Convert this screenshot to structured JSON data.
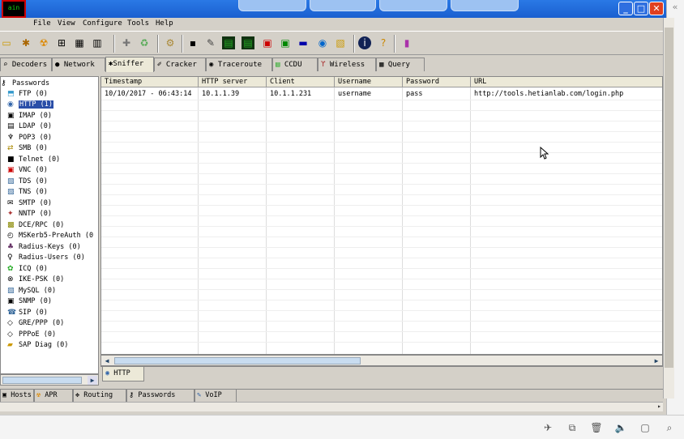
{
  "titlebar": {
    "app_icon_text": "ain",
    "buttons": {
      "minimize": "_",
      "maximize": "□",
      "close": "✕"
    }
  },
  "menubar": [
    "File",
    "View",
    "Configure",
    "Tools",
    "Help"
  ],
  "toolbar_icons": [
    "open-icon",
    "start-sniffer-icon",
    "start-apr-icon",
    "network-icon",
    "hex-icon",
    "add-icon",
    "remove-icon",
    "settings-icon",
    "decoders-icon",
    "ccdu-icon",
    "report-icon",
    "hash-icon",
    "protocol-icon",
    "voip-icon",
    "info-icon",
    "help-icon",
    "exit-icon"
  ],
  "top_tabs": [
    {
      "label": "Decoders",
      "icon": "decoders-icon"
    },
    {
      "label": "Network",
      "icon": "network-icon"
    },
    {
      "label": "Sniffer",
      "icon": "sniffer-icon",
      "active": true
    },
    {
      "label": "Cracker",
      "icon": "cracker-icon"
    },
    {
      "label": "Traceroute",
      "icon": "traceroute-icon"
    },
    {
      "label": "CCDU",
      "icon": "ccdu-icon"
    },
    {
      "label": "Wireless",
      "icon": "wireless-icon"
    },
    {
      "label": "Query",
      "icon": "query-icon"
    }
  ],
  "tree": {
    "root": "Passwords",
    "items": [
      {
        "label": "FTP  (0)"
      },
      {
        "label": "HTTP (1)",
        "selected": true
      },
      {
        "label": "IMAP  (0)"
      },
      {
        "label": "LDAP  (0)"
      },
      {
        "label": "POP3  (0)"
      },
      {
        "label": "SMB  (0)"
      },
      {
        "label": "Telnet  (0)"
      },
      {
        "label": "VNC  (0)"
      },
      {
        "label": "TDS  (0)"
      },
      {
        "label": "TNS  (0)"
      },
      {
        "label": "SMTP  (0)"
      },
      {
        "label": "NNTP  (0)"
      },
      {
        "label": "DCE/RPC  (0)"
      },
      {
        "label": "MSKerb5-PreAuth  (0"
      },
      {
        "label": "Radius-Keys  (0)"
      },
      {
        "label": "Radius-Users  (0)"
      },
      {
        "label": "ICQ  (0)"
      },
      {
        "label": "IKE-PSK  (0)"
      },
      {
        "label": "MySQL  (0)"
      },
      {
        "label": "SNMP  (0)"
      },
      {
        "label": "SIP  (0)"
      },
      {
        "label": "GRE/PPP  (0)"
      },
      {
        "label": "PPPoE  (0)"
      },
      {
        "label": "SAP Diag  (0)"
      }
    ]
  },
  "grid": {
    "columns": [
      "Timestamp",
      "HTTP server",
      "Client",
      "Username",
      "Password",
      "URL"
    ],
    "rows": [
      [
        "10/10/2017 - 06:43:14",
        "10.1.1.39",
        "10.1.1.231",
        "username",
        "pass",
        "http://tools.hetianlab.com/login.php"
      ]
    ]
  },
  "subtab": "HTTP",
  "bottom_tabs": [
    "Hosts",
    "APR",
    "Routing",
    "Passwords",
    "VoIP"
  ]
}
